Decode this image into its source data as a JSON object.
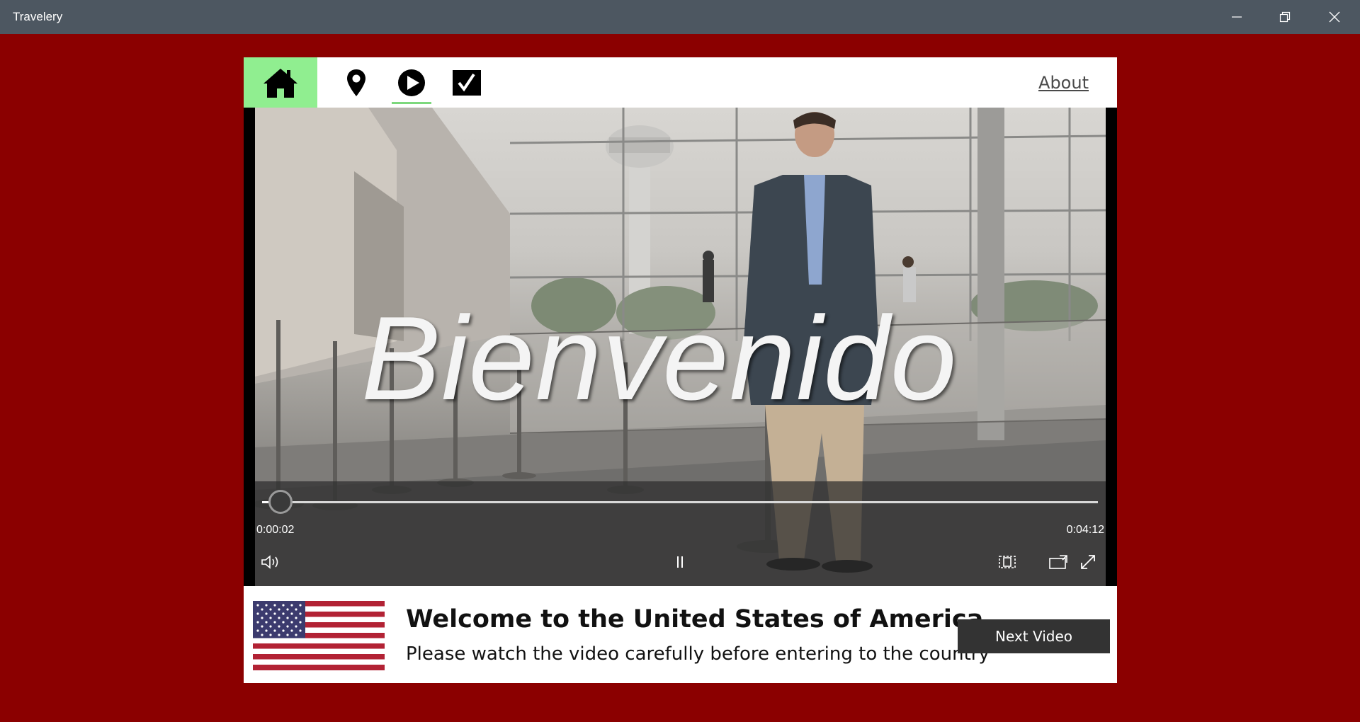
{
  "window": {
    "title": "Travelery",
    "controls": [
      "minimize-icon",
      "restore-icon",
      "close-icon"
    ]
  },
  "nav": {
    "items": [
      {
        "name": "home",
        "icon": "home-icon",
        "selected": true
      },
      {
        "name": "location",
        "icon": "map-pin-icon"
      },
      {
        "name": "video",
        "icon": "play-circle-icon",
        "active_underline": true
      },
      {
        "name": "checklist",
        "icon": "checkbox-icon"
      }
    ],
    "about_label": "About"
  },
  "video": {
    "overlay_text": "Bienvenido",
    "current_time": "0:00:02",
    "total_time": "0:04:12",
    "progress_fraction": 0.008,
    "controls": [
      "volume-icon",
      "pause-icon",
      "aspect-ratio-icon",
      "cast-icon",
      "fullscreen-icon"
    ]
  },
  "info": {
    "flag": "us-flag",
    "title": "Welcome to the United States of America",
    "subtitle": "Please watch the video carefully before entering to the country",
    "next_button": "Next Video"
  },
  "colors": {
    "background": "#8b0000",
    "titlebar": "#4d5761",
    "nav_selected": "#90ee90",
    "button": "#333333"
  }
}
